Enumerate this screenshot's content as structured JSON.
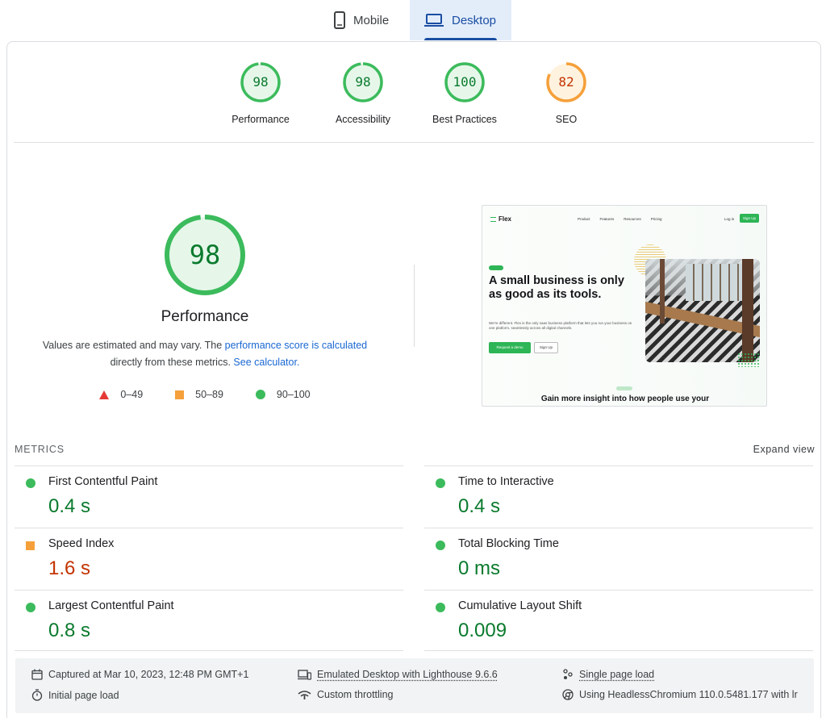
{
  "tabs": [
    {
      "label": "Mobile",
      "icon": "phone-icon",
      "active": false
    },
    {
      "label": "Desktop",
      "icon": "laptop-icon",
      "active": true
    }
  ],
  "summary_scores": [
    {
      "label": "Performance",
      "score": "98",
      "status": "good"
    },
    {
      "label": "Accessibility",
      "score": "98",
      "status": "good"
    },
    {
      "label": "Best Practices",
      "score": "100",
      "status": "good"
    },
    {
      "label": "SEO",
      "score": "82",
      "status": "average"
    }
  ],
  "colors": {
    "good": "#0cce6b",
    "good_text": "#0a7a2d",
    "good_fill": "#e6f7ea",
    "average": "#ffa400",
    "average_text": "#c33300",
    "average_fill": "#fff3e0",
    "poor": "#e53935",
    "link": "#1967d2",
    "tab_active_bg": "#e3edfa"
  },
  "performance": {
    "score": "98",
    "score_fraction": 0.98,
    "title": "Performance",
    "desc_prefix": "Values are estimated and may vary. The ",
    "desc_link": "performance score is calculated",
    "desc_middle": "directly from these metrics. ",
    "desc_link2": "See calculator.",
    "legend": [
      {
        "shape": "triangle",
        "range": "0–49"
      },
      {
        "shape": "square",
        "range": "50–89"
      },
      {
        "shape": "circle",
        "range": "90–100"
      }
    ]
  },
  "preview": {
    "logo": "Flex",
    "nav": [
      "Product",
      "Features",
      "Resources",
      "Pricing"
    ],
    "login": "Log in",
    "signup": "Sign Up",
    "headline": "A small business is only as good as its tools.",
    "paragraph": "We're different. Flex is the only saas business platform that lets you run your business on one platform, seamlessly across all digital channels.",
    "cta_primary": "Request a demo",
    "cta_secondary": "Sign Up",
    "section_title": "Gain more insight into how people use your"
  },
  "metrics": {
    "heading": "METRICS",
    "expand": "Expand view",
    "items": [
      {
        "name": "First Contentful Paint",
        "value": "0.4 s",
        "status": "good"
      },
      {
        "name": "Time to Interactive",
        "value": "0.4 s",
        "status": "good"
      },
      {
        "name": "Speed Index",
        "value": "1.6 s",
        "status": "average"
      },
      {
        "name": "Total Blocking Time",
        "value": "0 ms",
        "status": "good"
      },
      {
        "name": "Largest Contentful Paint",
        "value": "0.8 s",
        "status": "good"
      },
      {
        "name": "Cumulative Layout Shift",
        "value": "0.009",
        "status": "good"
      }
    ]
  },
  "footer": {
    "captured": "Captured at Mar 10, 2023, 12:48 PM GMT+1",
    "emulated": "Emulated Desktop with Lighthouse 9.6.6",
    "single": "Single page load",
    "initial": "Initial page load",
    "throttling": "Custom throttling",
    "using": "Using HeadlessChromium 110.0.5481.177 with lr"
  }
}
